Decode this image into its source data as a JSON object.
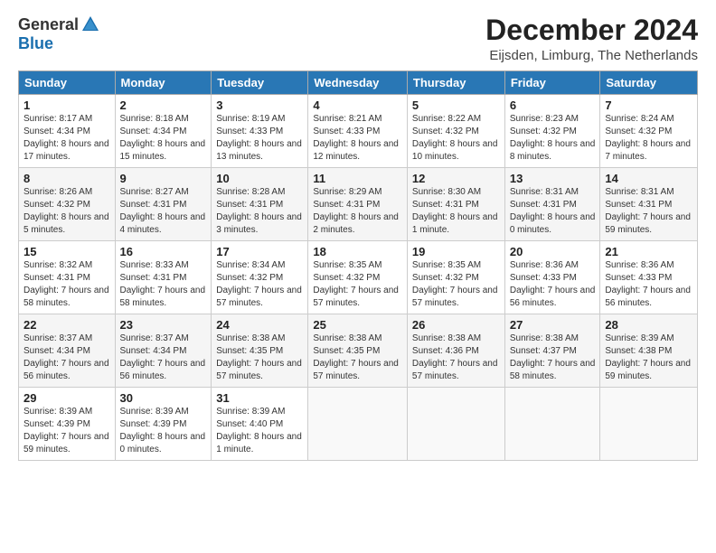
{
  "logo": {
    "general": "General",
    "blue": "Blue"
  },
  "title": "December 2024",
  "location": "Eijsden, Limburg, The Netherlands",
  "days_of_week": [
    "Sunday",
    "Monday",
    "Tuesday",
    "Wednesday",
    "Thursday",
    "Friday",
    "Saturday"
  ],
  "weeks": [
    [
      {
        "day": "1",
        "sunrise": "8:17 AM",
        "sunset": "4:34 PM",
        "daylight": "8 hours and 17 minutes."
      },
      {
        "day": "2",
        "sunrise": "8:18 AM",
        "sunset": "4:34 PM",
        "daylight": "8 hours and 15 minutes."
      },
      {
        "day": "3",
        "sunrise": "8:19 AM",
        "sunset": "4:33 PM",
        "daylight": "8 hours and 13 minutes."
      },
      {
        "day": "4",
        "sunrise": "8:21 AM",
        "sunset": "4:33 PM",
        "daylight": "8 hours and 12 minutes."
      },
      {
        "day": "5",
        "sunrise": "8:22 AM",
        "sunset": "4:32 PM",
        "daylight": "8 hours and 10 minutes."
      },
      {
        "day": "6",
        "sunrise": "8:23 AM",
        "sunset": "4:32 PM",
        "daylight": "8 hours and 8 minutes."
      },
      {
        "day": "7",
        "sunrise": "8:24 AM",
        "sunset": "4:32 PM",
        "daylight": "8 hours and 7 minutes."
      }
    ],
    [
      {
        "day": "8",
        "sunrise": "8:26 AM",
        "sunset": "4:32 PM",
        "daylight": "8 hours and 5 minutes."
      },
      {
        "day": "9",
        "sunrise": "8:27 AM",
        "sunset": "4:31 PM",
        "daylight": "8 hours and 4 minutes."
      },
      {
        "day": "10",
        "sunrise": "8:28 AM",
        "sunset": "4:31 PM",
        "daylight": "8 hours and 3 minutes."
      },
      {
        "day": "11",
        "sunrise": "8:29 AM",
        "sunset": "4:31 PM",
        "daylight": "8 hours and 2 minutes."
      },
      {
        "day": "12",
        "sunrise": "8:30 AM",
        "sunset": "4:31 PM",
        "daylight": "8 hours and 1 minute."
      },
      {
        "day": "13",
        "sunrise": "8:31 AM",
        "sunset": "4:31 PM",
        "daylight": "8 hours and 0 minutes."
      },
      {
        "day": "14",
        "sunrise": "8:31 AM",
        "sunset": "4:31 PM",
        "daylight": "7 hours and 59 minutes."
      }
    ],
    [
      {
        "day": "15",
        "sunrise": "8:32 AM",
        "sunset": "4:31 PM",
        "daylight": "7 hours and 58 minutes."
      },
      {
        "day": "16",
        "sunrise": "8:33 AM",
        "sunset": "4:31 PM",
        "daylight": "7 hours and 58 minutes."
      },
      {
        "day": "17",
        "sunrise": "8:34 AM",
        "sunset": "4:32 PM",
        "daylight": "7 hours and 57 minutes."
      },
      {
        "day": "18",
        "sunrise": "8:35 AM",
        "sunset": "4:32 PM",
        "daylight": "7 hours and 57 minutes."
      },
      {
        "day": "19",
        "sunrise": "8:35 AM",
        "sunset": "4:32 PM",
        "daylight": "7 hours and 57 minutes."
      },
      {
        "day": "20",
        "sunrise": "8:36 AM",
        "sunset": "4:33 PM",
        "daylight": "7 hours and 56 minutes."
      },
      {
        "day": "21",
        "sunrise": "8:36 AM",
        "sunset": "4:33 PM",
        "daylight": "7 hours and 56 minutes."
      }
    ],
    [
      {
        "day": "22",
        "sunrise": "8:37 AM",
        "sunset": "4:34 PM",
        "daylight": "7 hours and 56 minutes."
      },
      {
        "day": "23",
        "sunrise": "8:37 AM",
        "sunset": "4:34 PM",
        "daylight": "7 hours and 56 minutes."
      },
      {
        "day": "24",
        "sunrise": "8:38 AM",
        "sunset": "4:35 PM",
        "daylight": "7 hours and 57 minutes."
      },
      {
        "day": "25",
        "sunrise": "8:38 AM",
        "sunset": "4:35 PM",
        "daylight": "7 hours and 57 minutes."
      },
      {
        "day": "26",
        "sunrise": "8:38 AM",
        "sunset": "4:36 PM",
        "daylight": "7 hours and 57 minutes."
      },
      {
        "day": "27",
        "sunrise": "8:38 AM",
        "sunset": "4:37 PM",
        "daylight": "7 hours and 58 minutes."
      },
      {
        "day": "28",
        "sunrise": "8:39 AM",
        "sunset": "4:38 PM",
        "daylight": "7 hours and 59 minutes."
      }
    ],
    [
      {
        "day": "29",
        "sunrise": "8:39 AM",
        "sunset": "4:39 PM",
        "daylight": "7 hours and 59 minutes."
      },
      {
        "day": "30",
        "sunrise": "8:39 AM",
        "sunset": "4:39 PM",
        "daylight": "8 hours and 0 minutes."
      },
      {
        "day": "31",
        "sunrise": "8:39 AM",
        "sunset": "4:40 PM",
        "daylight": "8 hours and 1 minute."
      },
      null,
      null,
      null,
      null
    ]
  ]
}
